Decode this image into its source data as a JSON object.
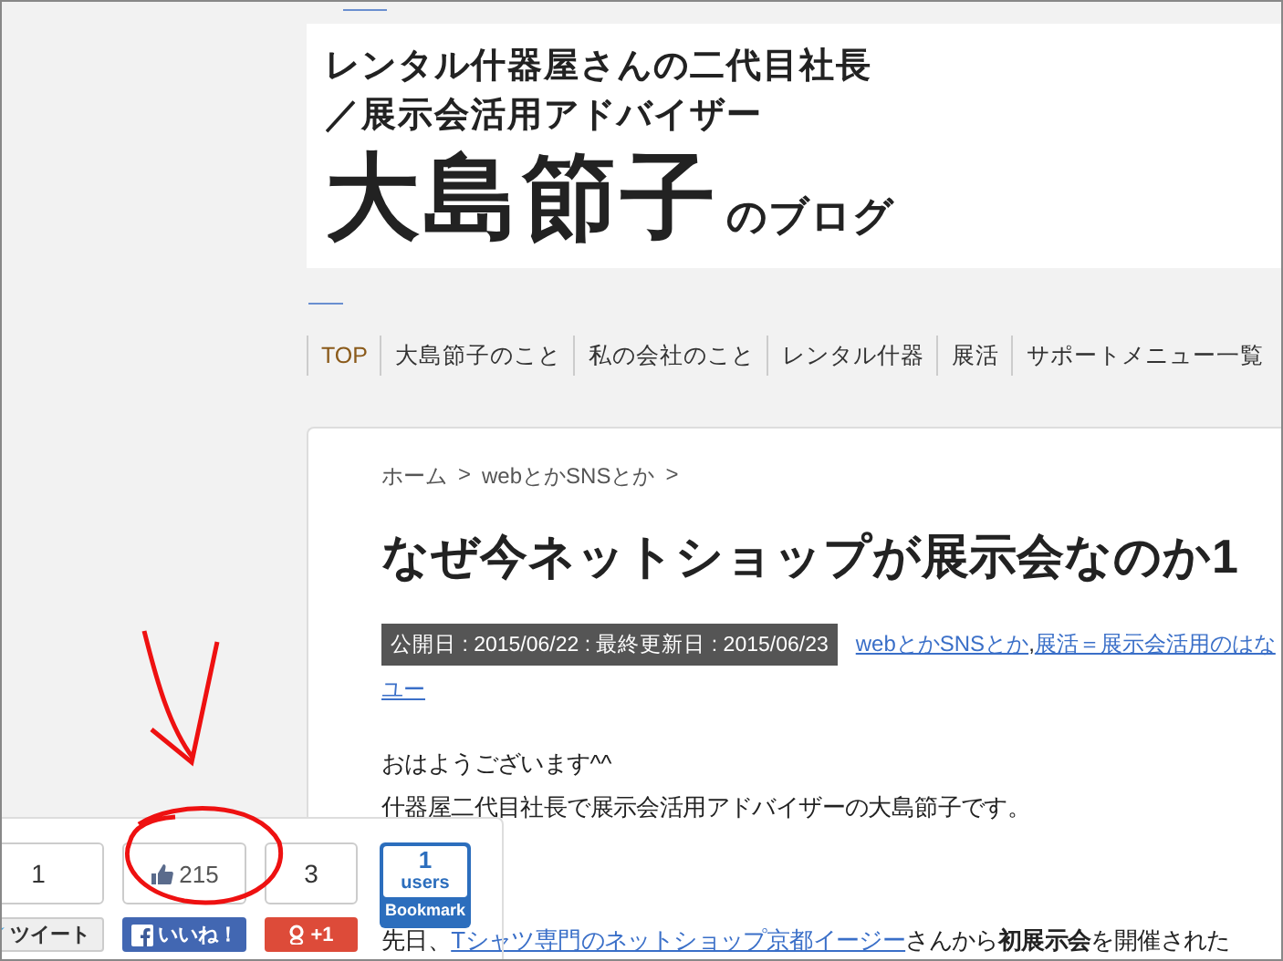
{
  "header": {
    "tagline_lines": [
      "レンタル什器屋さんの二代目社長",
      "／展示会活用アドバイザー"
    ],
    "name": "大島節子",
    "name_suffix": "のブログ"
  },
  "nav": {
    "items": [
      {
        "label": "TOP",
        "selected": true
      },
      {
        "label": "大島節子のこと",
        "selected": false
      },
      {
        "label": "私の会社のこと",
        "selected": false
      },
      {
        "label": "レンタル什器",
        "selected": false
      },
      {
        "label": "展活",
        "selected": false
      },
      {
        "label": "サポートメニュー一覧",
        "selected": false
      }
    ]
  },
  "article": {
    "breadcrumb": [
      "ホーム",
      "webとかSNSとか"
    ],
    "breadcrumb_separator": ">",
    "title": "なぜ今ネットショップが展示会なのか1",
    "meta": "公開日 : 2015/06/22 : 最終更新日 : 2015/06/23",
    "categories": [
      "webとかSNSとか",
      "展活＝展示会活用のはな"
    ],
    "category_separator": ",",
    "categories_continued": "ユー",
    "body": [
      {
        "kind": "text",
        "text": "おはようございます^^"
      },
      {
        "kind": "text",
        "text": "什器屋二代目社長で展示会活用アドバイザーの大島節子です。"
      },
      {
        "kind": "link",
        "before": "先日、",
        "link": "Tシャツ専門のネットショップ京都イージー",
        "after": "さんから**初展示会**を開催された"
      }
    ]
  },
  "share": [
    {
      "kind": "tweet",
      "count": "1",
      "label": "ツイート"
    },
    {
      "kind": "like",
      "count": "215",
      "label": "いいね！"
    },
    {
      "kind": "plusone",
      "count": "3",
      "label": "+1"
    },
    {
      "kind": "bookmark",
      "count": "1",
      "unit": "users",
      "label": "Bookmark"
    }
  ]
}
